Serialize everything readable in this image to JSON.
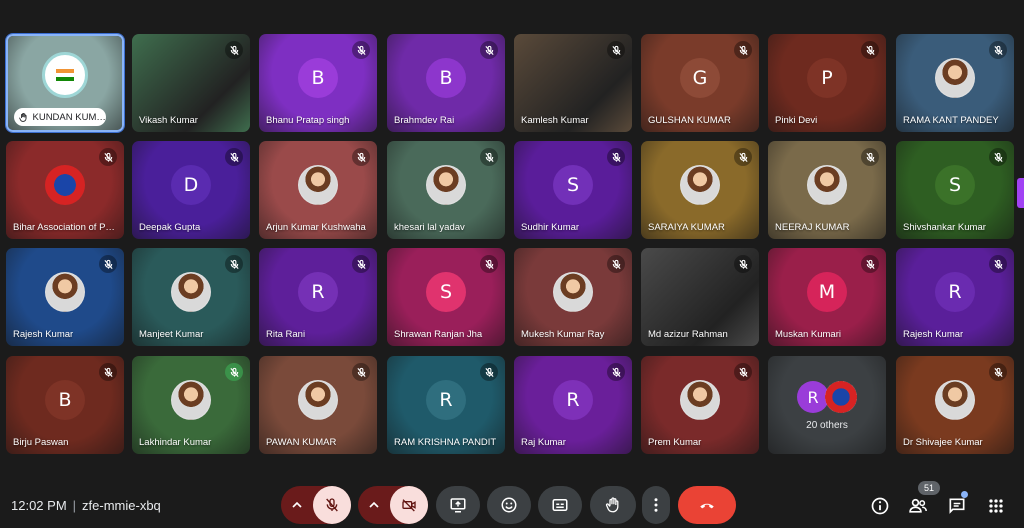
{
  "meeting": {
    "time": "12:02 PM",
    "code": "zfe-mmie-xbq",
    "participants_count": "51"
  },
  "colors": {
    "end_call": "#ea4335",
    "muted_pair_bg": "#6a1b1b",
    "accent": "#8ab4f8"
  },
  "tiles": [
    {
      "name": "KUNDAN KUMAR",
      "type": "logo",
      "bg": "#8aa6a3",
      "mic": "raised-hand",
      "active": true
    },
    {
      "name": "Vikash Kumar",
      "type": "video",
      "bg": "#3f6e4e",
      "mic": "muted"
    },
    {
      "name": "Bhanu Pratap singh",
      "type": "initial",
      "initial": "B",
      "bg": "#7e2fc2",
      "avatar": "#9a3cd9",
      "mic": "muted"
    },
    {
      "name": "Brahmdev Rai",
      "type": "initial",
      "initial": "B",
      "bg": "#6f2aa8",
      "avatar": "#8d36cc",
      "mic": "muted"
    },
    {
      "name": "Kamlesh Kumar",
      "type": "video",
      "bg": "#5a4a3a",
      "mic": "muted"
    },
    {
      "name": "GULSHAN KUMAR",
      "type": "initial",
      "initial": "G",
      "bg": "#7a3b2a",
      "avatar": "#8d4a37",
      "mic": "muted"
    },
    {
      "name": "Pinki Devi",
      "type": "initial",
      "initial": "P",
      "bg": "#6e2a1f",
      "avatar": "#7e3326",
      "mic": "muted"
    },
    {
      "name": "RAMA KANT PANDEY",
      "type": "photo",
      "bg": "#3a5c7a",
      "mic": "muted"
    },
    {
      "name": "Bihar Association of Persons with Disability",
      "type": "logo2",
      "bg": "#8b2a2a",
      "mic": "muted"
    },
    {
      "name": "Deepak Gupta",
      "type": "initial",
      "initial": "D",
      "bg": "#4a1f9a",
      "avatar": "#5a2bb0",
      "mic": "muted"
    },
    {
      "name": "Arjun Kumar Kushwaha",
      "type": "photo",
      "bg": "#9a4a4a",
      "mic": "muted"
    },
    {
      "name": "khesari lal yadav",
      "type": "photo",
      "bg": "#4a6a5a",
      "mic": "muted"
    },
    {
      "name": "Sudhir Kumar",
      "type": "initial",
      "initial": "S",
      "bg": "#5a1d9a",
      "avatar": "#7230b8",
      "mic": "muted"
    },
    {
      "name": "SARAIYA KUMAR",
      "type": "photo",
      "bg": "#8a6a2a",
      "mic": "muted"
    },
    {
      "name": "NEERAJ KUMAR",
      "type": "photo",
      "bg": "#7a6a4a",
      "mic": "muted"
    },
    {
      "name": "Shivshankar Kumar",
      "type": "initial",
      "initial": "S",
      "bg": "#2e5e22",
      "avatar": "#3b7229",
      "mic": "muted"
    },
    {
      "name": "Rajesh Kumar",
      "type": "photo",
      "bg": "#1f4a8a",
      "mic": "muted"
    },
    {
      "name": "Manjeet Kumar",
      "type": "photo",
      "bg": "#2a5a5a",
      "mic": "muted"
    },
    {
      "name": "Rita Rani",
      "type": "initial",
      "initial": "R",
      "bg": "#5e1f9a",
      "avatar": "#7530b5",
      "mic": "muted"
    },
    {
      "name": "Shrawan Ranjan Jha",
      "type": "initial",
      "initial": "S",
      "bg": "#9a1f5a",
      "avatar": "#e0336e",
      "mic": "muted"
    },
    {
      "name": "Mukesh Kumar Ray",
      "type": "photo",
      "bg": "#7a3a3a",
      "mic": "muted"
    },
    {
      "name": "Md azizur Rahman",
      "type": "video",
      "bg": "#4a4a4a",
      "mic": "muted"
    },
    {
      "name": "Muskan Kumari",
      "type": "initial",
      "initial": "M",
      "bg": "#9a1f4a",
      "avatar": "#d6245a",
      "mic": "muted"
    },
    {
      "name": "Rajesh Kumar",
      "type": "initial",
      "initial": "R",
      "bg": "#5a1f9a",
      "avatar": "#6a2bb0",
      "mic": "muted"
    },
    {
      "name": "Birju Paswan",
      "type": "initial",
      "initial": "B",
      "bg": "#6e2a1f",
      "avatar": "#7e3326",
      "mic": "muted"
    },
    {
      "name": "Lakhindar Kumar",
      "type": "photo",
      "bg": "#3a6a3a",
      "mic": "muted-green"
    },
    {
      "name": "PAWAN KUMAR",
      "type": "photo",
      "bg": "#7a4a3a",
      "mic": "muted"
    },
    {
      "name": "RAM KRISHNA PANDIT",
      "type": "initial",
      "initial": "R",
      "bg": "#1f5a6a",
      "avatar": "#2f6e7e",
      "mic": "muted"
    },
    {
      "name": "Raj Kumar",
      "type": "initial",
      "initial": "R",
      "bg": "#6a1f9a",
      "avatar": "#7e30b8",
      "mic": "muted"
    },
    {
      "name": "Prem Kumar",
      "type": "photo",
      "bg": "#7a2a2a",
      "mic": "muted"
    },
    {
      "name": "20 others",
      "type": "others",
      "initial": "R",
      "bg": "#3c4043",
      "avatar": "#9a3cd9"
    },
    {
      "name": "Dr Shivajee Kumar",
      "type": "photo",
      "bg": "#7a3a1f",
      "mic": "muted"
    }
  ],
  "icons": {
    "raise_hand": "raise-hand-icon",
    "mic_off": "mic-off-icon",
    "cam_off": "camera-off-icon",
    "present": "present-icon",
    "emoji": "emoji-icon",
    "captions": "captions-icon",
    "hand": "hand-icon",
    "more": "more-vert-icon",
    "end": "end-call-icon",
    "info": "info-icon",
    "people": "people-icon",
    "chat": "chat-icon",
    "activities": "apps-icon"
  }
}
